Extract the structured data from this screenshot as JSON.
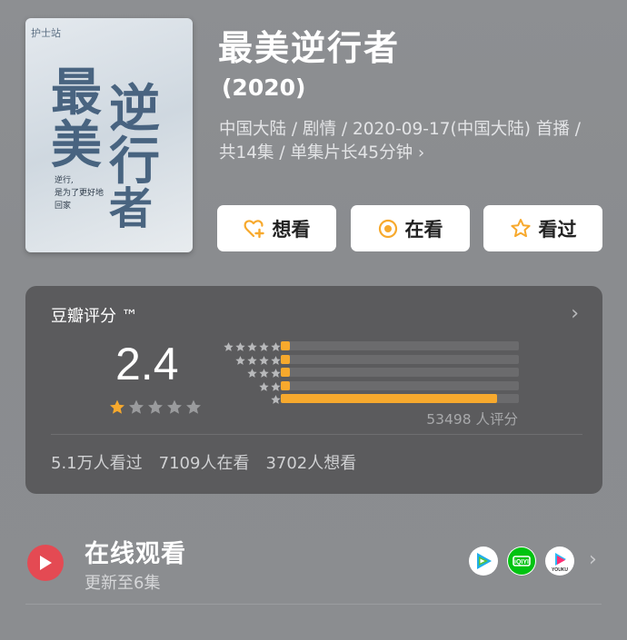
{
  "movie": {
    "title": "最美逆行者",
    "year": "(2020)",
    "meta": "中国大陆 / 剧情 / 2020-09-17(中国大陆) 首播 / 共14集 / 单集片长45分钟",
    "poster": {
      "tag": "护士站",
      "title_chars": [
        "最",
        "逆",
        "美",
        "行",
        "者"
      ],
      "tagline_1": "逆行,",
      "tagline_2": "是为了更好地",
      "tagline_3": "回家"
    }
  },
  "actions": {
    "want": "想看",
    "watching": "在看",
    "watched": "看过"
  },
  "rating": {
    "heading": "豆瓣评分 ™",
    "score": "2.4",
    "score_stars": 1,
    "distribution": [
      {
        "stars": 5,
        "fraction": 0.04
      },
      {
        "stars": 4,
        "fraction": 0.04
      },
      {
        "stars": 3,
        "fraction": 0.04
      },
      {
        "stars": 2,
        "fraction": 0.04
      },
      {
        "stars": 1,
        "fraction": 0.91
      }
    ],
    "count": "53498 人评分",
    "stats": {
      "seen": "5.1万人看过",
      "watching": "7109人在看",
      "want": "3702人想看"
    }
  },
  "online": {
    "title": "在线观看",
    "subtitle": "更新至6集",
    "platforms": [
      "tencent-video-icon",
      "iqiyi-icon",
      "youku-icon"
    ],
    "platform_labels": {
      "iqiyi": "iQIYI",
      "youku": "YOUKU"
    }
  },
  "colors": {
    "accent_star": "#f7a92d",
    "play_red": "#e44a53"
  }
}
